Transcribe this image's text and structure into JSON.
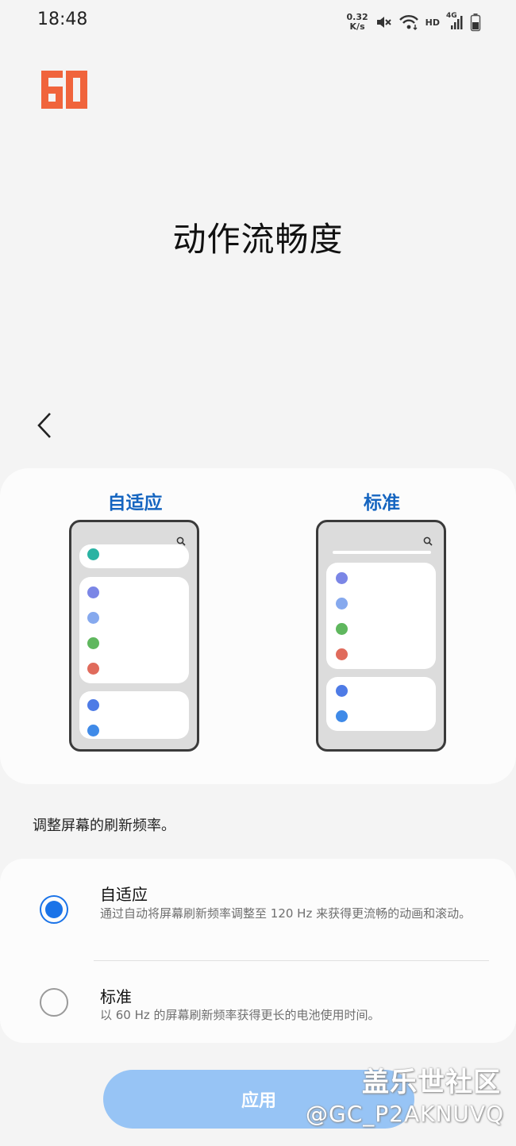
{
  "status_bar": {
    "time": "18:48",
    "net_speed_value": "0.32",
    "net_speed_unit": "K/s",
    "hd_label": "HD",
    "network_label": "4G",
    "icons": [
      "mute-icon",
      "wifi-icon",
      "signal-icon",
      "battery-icon"
    ]
  },
  "header": {
    "title": "动作流畅度"
  },
  "preview": {
    "adaptive_label": "自适应",
    "standard_label": "标准",
    "dot_colors": [
      "#7b86e6",
      "#86a9ee",
      "#5fb75e",
      "#e06b5c",
      "#4e7be6",
      "#3f8ae8",
      "#2ab3a3"
    ]
  },
  "description": "调整屏幕的刷新频率。",
  "options": [
    {
      "title": "自适应",
      "subtitle": "通过自动将屏幕刷新频率调整至 120 Hz 来获得更流畅的动画和滚动。",
      "selected": true
    },
    {
      "title": "标准",
      "subtitle": "以 60 Hz 的屏幕刷新频率获得更长的电池使用时间。",
      "selected": false
    }
  ],
  "apply_label": "应用",
  "watermark": {
    "line1": "盖乐世社区",
    "line2": "@GC_P2AKNUVQ"
  },
  "colors": {
    "accent": "#1a73e8",
    "label_blue": "#1565c0",
    "logo_orange": "#f0643c",
    "apply_bg": "#97c4f5"
  }
}
